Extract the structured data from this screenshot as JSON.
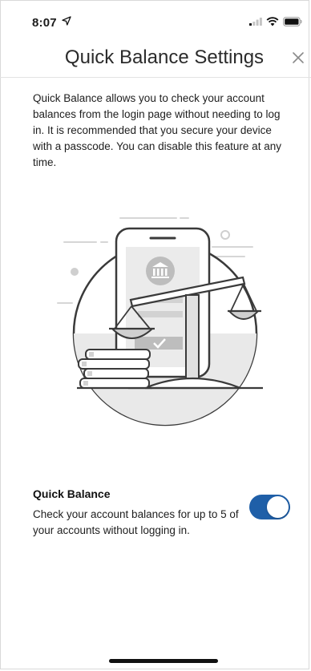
{
  "status_bar": {
    "time": "8:07",
    "icons": [
      "location-arrow-icon",
      "signal-icon",
      "wifi-icon",
      "battery-icon"
    ]
  },
  "header": {
    "title": "Quick Balance Settings",
    "close_icon": "close-icon"
  },
  "intro_text": "Quick Balance allows you to check your account balances from the login page without needing to log in. It is recommended that you secure your device with a passcode. You can disable this feature at any time.",
  "illustration": "phone-bank-scale-coins-illustration",
  "quick_balance": {
    "title": "Quick Balance",
    "description": "Check your account balances for up to 5 of your accounts without logging in.",
    "enabled": true
  },
  "colors": {
    "toggle_on": "#1f5fa8",
    "text": "#1e1e1e",
    "illustration_gray": "#cfcfcf",
    "illustration_stroke": "#3a3a3a"
  }
}
